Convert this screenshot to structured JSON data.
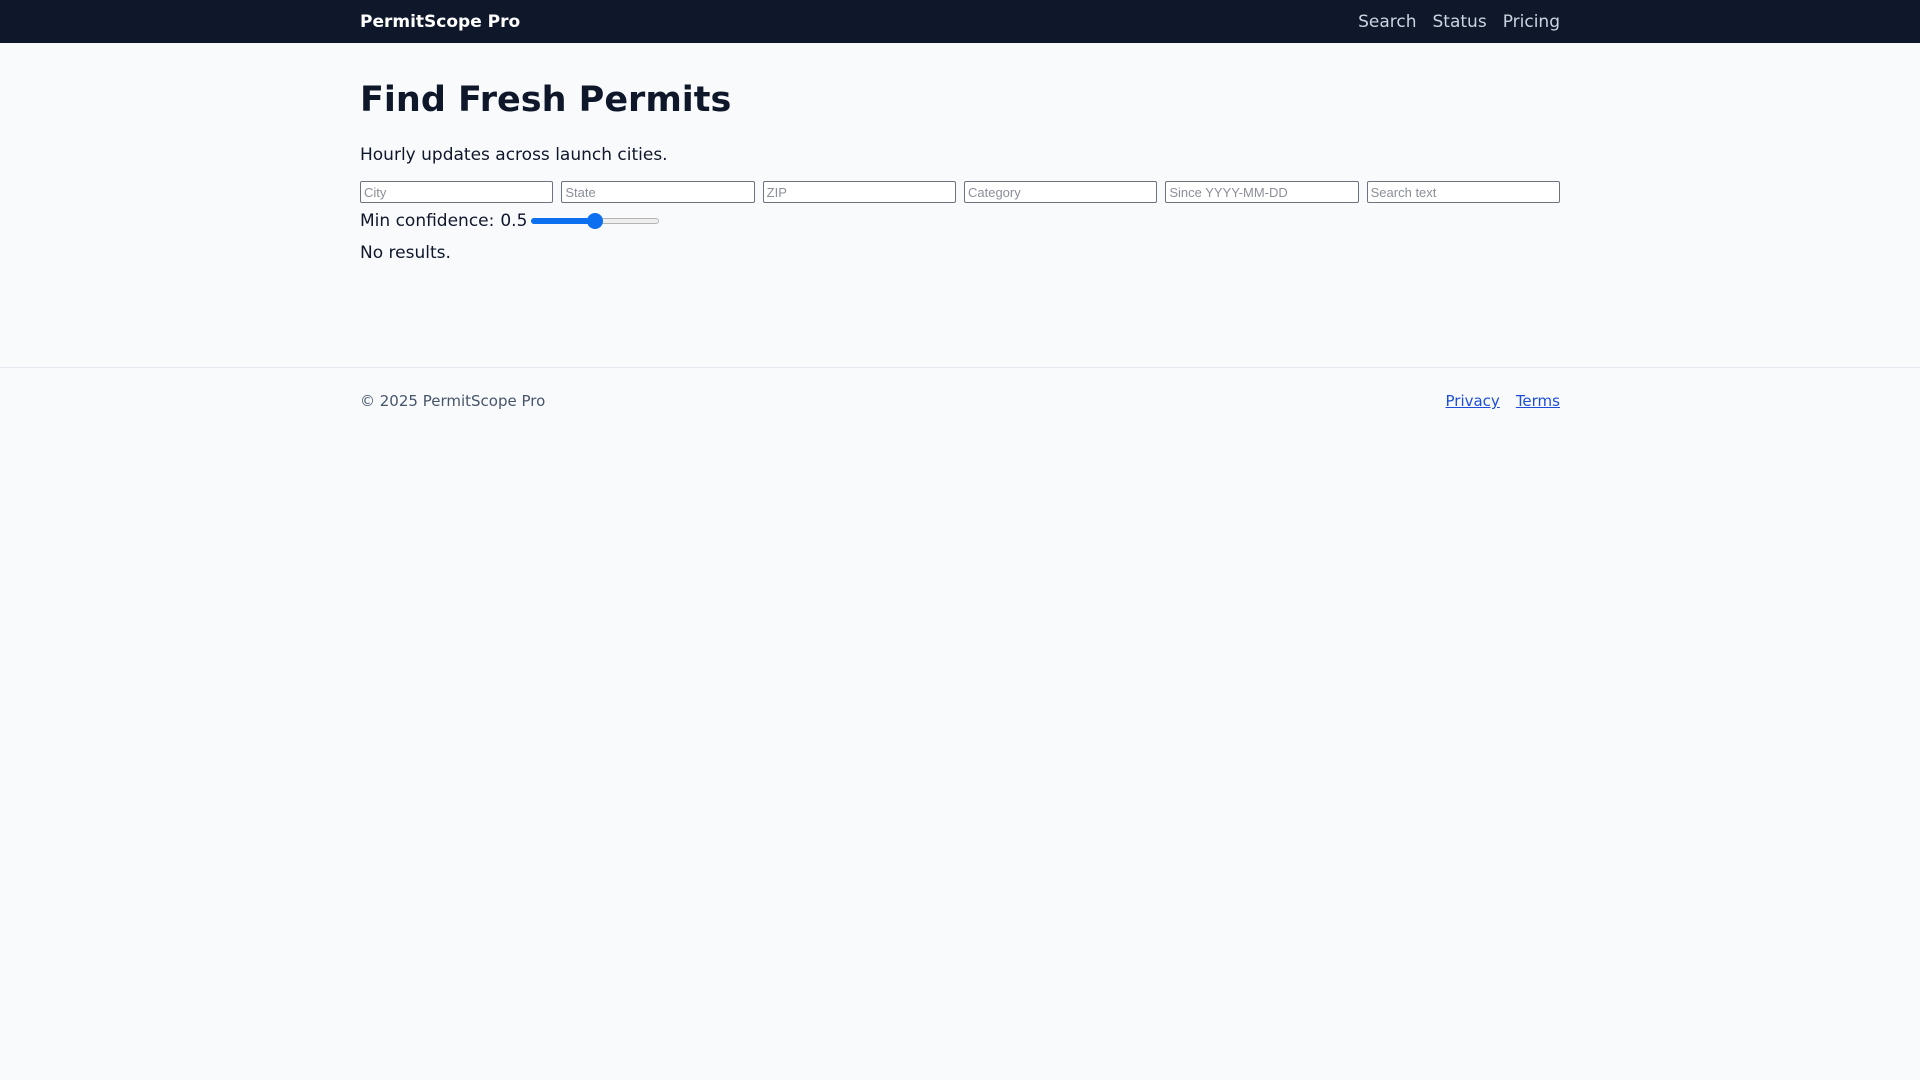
{
  "header": {
    "brand": "PermitScope Pro",
    "nav": [
      "Search",
      "Status",
      "Pricing"
    ]
  },
  "main": {
    "title": "Find Fresh Permits",
    "subtitle": "Hourly updates across launch cities.",
    "filters": {
      "city_placeholder": "City",
      "state_placeholder": "State",
      "zip_placeholder": "ZIP",
      "category_placeholder": "Category",
      "since_placeholder": "Since YYYY-MM-DD",
      "search_placeholder": "Search text"
    },
    "confidence": {
      "label": "Min confidence:",
      "value": "0.5",
      "fraction": 0.5
    },
    "results_text": "No results."
  },
  "footer": {
    "copyright": "© 2025 PermitScope Pro",
    "links": [
      "Privacy",
      "Terms"
    ]
  },
  "colors": {
    "nav_bg": "#0f172a",
    "accent": "#0b6ff0",
    "link": "#1d4ed8",
    "page_bg": "#f8fafc"
  }
}
